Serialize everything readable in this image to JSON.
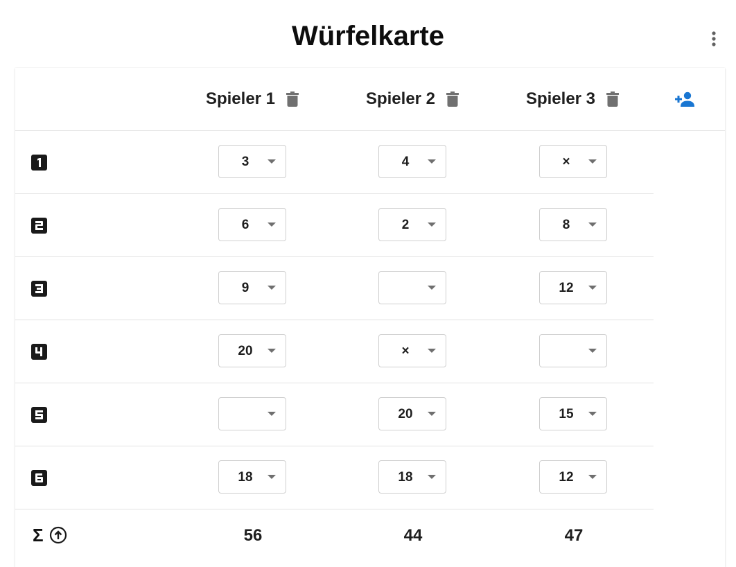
{
  "header": {
    "title": "Würfelkarte",
    "menu_icon": "more-vert-icon",
    "add_player_icon": "person-add-icon",
    "accent_color": "#1976d2"
  },
  "players": [
    {
      "name": "Spieler 1",
      "delete_icon": "trash-icon"
    },
    {
      "name": "Spieler 2",
      "delete_icon": "trash-icon"
    },
    {
      "name": "Spieler 3",
      "delete_icon": "trash-icon"
    }
  ],
  "rows": [
    {
      "die": "1",
      "die_icon": "dice-one-icon",
      "values": [
        "3",
        "4",
        "×"
      ]
    },
    {
      "die": "2",
      "die_icon": "dice-two-icon",
      "values": [
        "6",
        "2",
        "8"
      ]
    },
    {
      "die": "3",
      "die_icon": "dice-three-icon",
      "values": [
        "9",
        "",
        "12"
      ]
    },
    {
      "die": "4",
      "die_icon": "dice-four-icon",
      "values": [
        "20",
        "×",
        ""
      ]
    },
    {
      "die": "5",
      "die_icon": "dice-five-icon",
      "values": [
        "",
        "20",
        "15"
      ]
    },
    {
      "die": "6",
      "die_icon": "dice-six-icon",
      "values": [
        "18",
        "18",
        "12"
      ]
    }
  ],
  "totals": {
    "sigma": "Σ",
    "icon": "arrow-up-circle-icon",
    "values": [
      "56",
      "44",
      "47"
    ]
  }
}
